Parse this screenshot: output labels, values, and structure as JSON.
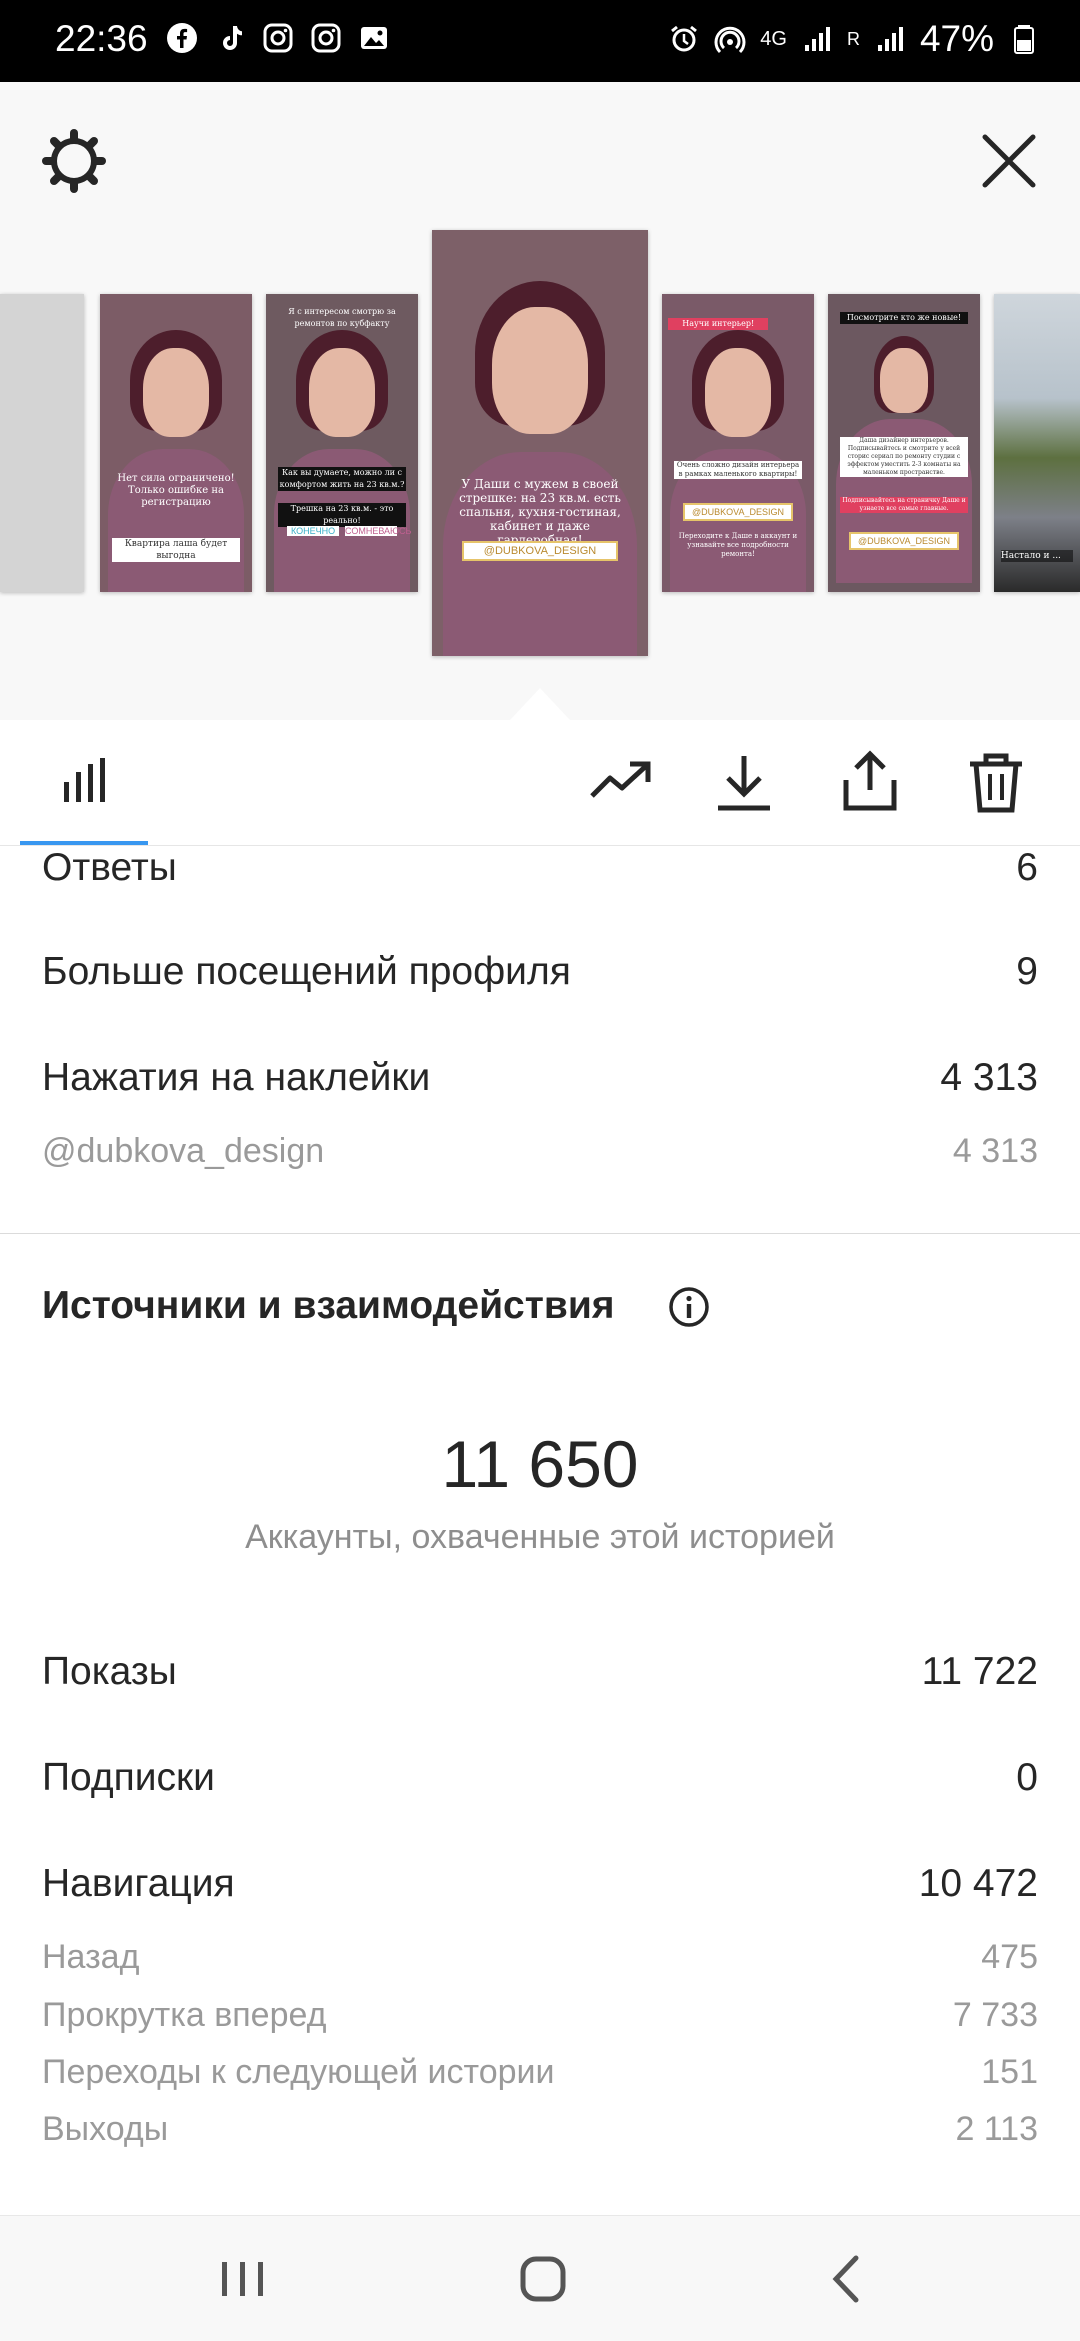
{
  "status_bar": {
    "time": "22:36",
    "network": "4G",
    "roaming": "R",
    "battery": "47%",
    "app_icons": [
      "facebook-icon",
      "tiktok-icon",
      "instagram-icon",
      "instagram-icon",
      "gallery-icon"
    ]
  },
  "story_strip": {
    "selected_index": 3,
    "thumbnails": [
      {
        "captions": []
      },
      {
        "captions": [
          "Нет сила ограничено! Только ошибке на регистрацию",
          "Квартира лаша будет выгодна"
        ]
      },
      {
        "captions": [
          "Я с интересом смотрю за ремонтов по кубфакту",
          "Как вы думаете, можно ли с комфортом жить на 23 кв.м.?",
          "Трешка на 23 кв.м. - это реально!"
        ],
        "choices": [
          "КОНЕЧНО",
          "СОМНЕВАЮСЬ"
        ]
      },
      {
        "captions": [
          "У Даши с мужем в своей стрешке: на 23 кв.м. есть спальня, кухня-гостиная, кабинет и даже гардеробная!"
        ],
        "tag": "@DUBKOVA_DESIGN"
      },
      {
        "captions": [
          "Научи интерьер!",
          "Очень сложно дизайн интерьера в рамках маленького квартиры!",
          "Переходите к Даше в аккаунт и узнавайте все подробности ремонта!"
        ],
        "tag": "@DUBKOVA_DESIGN"
      },
      {
        "captions": [
          "Посмотрите кто же новые!",
          "Даша дизайнер интерьеров. Подписывайтесь и смотрите у всей сторис сериал по ремонту студии с эффектом уместить 2-3 комнаты на маленьком пространстве.",
          "Подписывайтесь на страничку Даше и узнаете все самые главные."
        ],
        "tag": "@DUBKOVA_DESIGN"
      },
      {
        "captions": [
          "Настало и ..."
        ]
      }
    ]
  },
  "toolbar": {
    "tabs": [
      "insights-tab"
    ],
    "actions": [
      "promote-icon",
      "download-icon",
      "share-icon",
      "delete-icon"
    ]
  },
  "interactions": {
    "rows": [
      {
        "label": "Ответы",
        "value": "6"
      },
      {
        "label": "Больше посещений профиля",
        "value": "9"
      },
      {
        "label": "Нажатия на наклейки",
        "value": "4 313"
      }
    ],
    "sticker_rows": [
      {
        "label": "@dubkova_design",
        "value": "4 313"
      }
    ]
  },
  "discovery": {
    "title": "Источники и взаимодействия",
    "reach_value": "11 650",
    "reach_caption": "Аккаунты, охваченные этой историей",
    "rows": [
      {
        "label": "Показы",
        "value": "11 722"
      },
      {
        "label": "Подписки",
        "value": "0"
      },
      {
        "label": "Навигация",
        "value": "10 472"
      }
    ],
    "navigation_rows": [
      {
        "label": "Назад",
        "value": "475"
      },
      {
        "label": "Прокрутка вперед",
        "value": "7 733"
      },
      {
        "label": "Переходы к следующей истории",
        "value": "151"
      },
      {
        "label": "Выходы",
        "value": "2 113"
      }
    ]
  },
  "nav_bar": {
    "buttons": [
      "recent-apps-icon",
      "home-icon",
      "back-icon"
    ]
  }
}
